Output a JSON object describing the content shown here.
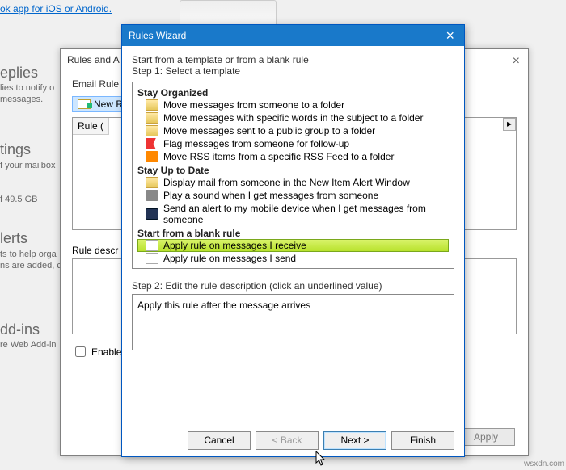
{
  "bg": {
    "link": "ok app for iOS or Android.",
    "replies_title": "eplies",
    "replies_desc": "lies to notify o\nmessages.",
    "tings_title": "tings",
    "tings_desc": "f your mailbox",
    "storage": "f 49.5 GB",
    "alerts_title": "lerts",
    "alerts_desc": "ts to help orga\nns are added, c",
    "addins_title": "dd-ins",
    "addins_desc": "re Web Add-in"
  },
  "rules": {
    "title": "Rules and A",
    "tab": "Email Rule",
    "new_btn": "New R",
    "grid_col": "Rule (",
    "desc_label": "Rule descr",
    "enable": "Enable",
    "apply": "Apply"
  },
  "wizard": {
    "title": "Rules Wizard",
    "head": "Start from a template or from a blank rule",
    "step1": "Step 1: Select a template",
    "grp_org": "Stay Organized",
    "org": [
      "Move messages from someone to a folder",
      "Move messages with specific words in the subject to a folder",
      "Move messages sent to a public group to a folder",
      "Flag messages from someone for follow-up",
      "Move RSS items from a specific RSS Feed to a folder"
    ],
    "grp_upd": "Stay Up to Date",
    "upd": [
      "Display mail from someone in the New Item Alert Window",
      "Play a sound when I get messages from someone",
      "Send an alert to my mobile device when I get messages from someone"
    ],
    "grp_blank": "Start from a blank rule",
    "blank": [
      "Apply rule on messages I receive",
      "Apply rule on messages I send"
    ],
    "step2_label": "Step 2: Edit the rule description (click an underlined value)",
    "step2_text": "Apply this rule after the message arrives",
    "btn_cancel": "Cancel",
    "btn_back": "< Back",
    "btn_next": "Next >",
    "btn_finish": "Finish"
  },
  "watermark": "wsxdn.com"
}
